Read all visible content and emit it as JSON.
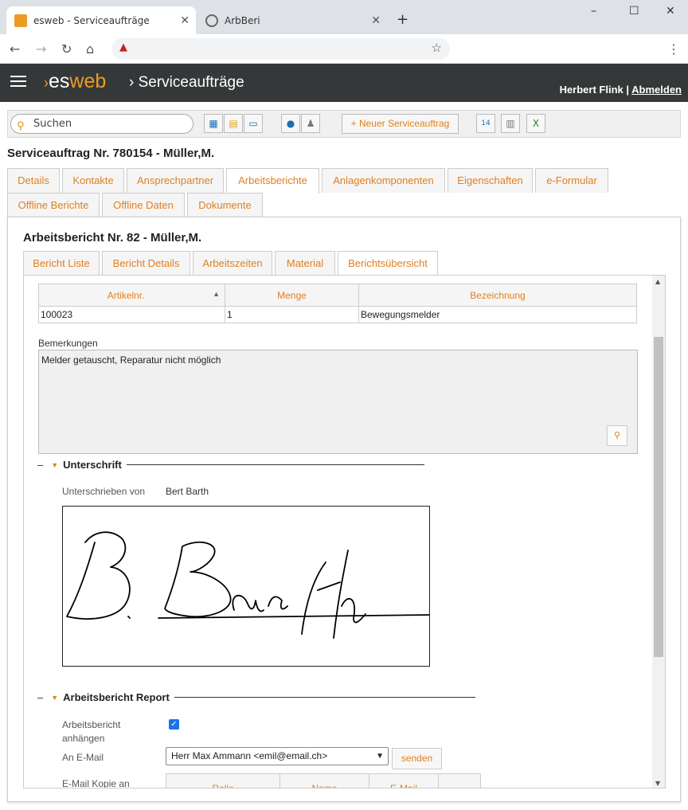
{
  "browser": {
    "tabs": [
      {
        "title": "esweb - Serviceaufträge",
        "active": true
      },
      {
        "title": "ArbBeri",
        "active": false
      }
    ],
    "new_tab": "+",
    "window_controls": {
      "minimize": "–",
      "maximize": "☐",
      "close": "✕"
    }
  },
  "app": {
    "logo_es": "es",
    "logo_web": "web",
    "breadcrumb": "Serviceaufträge",
    "user_name": "Herbert Flink",
    "separator": "|",
    "logout": "Abmelden",
    "accent": "#ec9c24"
  },
  "toolbar": {
    "search_placeholder": "Suchen",
    "new_button": "Neuer Serviceauftrag"
  },
  "page_title": "Serviceauftrag Nr. 780154 - Müller,M.",
  "main_tabs": [
    "Details",
    "Kontakte",
    "Ansprechpartner",
    "Arbeitsberichte",
    "Anlagenkomponenten",
    "Eigenschaften",
    "e-Formular",
    "Offline Berichte",
    "Offline Daten",
    "Dokumente"
  ],
  "active_main_tab": "Arbeitsberichte",
  "report": {
    "title": "Arbeitsbericht Nr. 82 - Müller,M.",
    "tabs": [
      "Bericht Liste",
      "Bericht Details",
      "Arbeitszeiten",
      "Material",
      "Berichtsübersicht"
    ],
    "active_tab": "Berichtsübersicht"
  },
  "material_table": {
    "columns": [
      "Artikelnr.",
      "Menge",
      "Bezeichnung"
    ],
    "rows": [
      [
        "100023",
        "1",
        "Bewegungsmelder"
      ]
    ]
  },
  "remarks": {
    "label": "Bemerkungen",
    "value": "Melder getauscht, Reparatur nicht möglich"
  },
  "signature": {
    "section_title": "Unterschrift",
    "signed_by_label": "Unterschrieben von",
    "signed_by_value": "Bert Barth"
  },
  "report_section": {
    "title": "Arbeitsbericht Report",
    "attach_label_line1": "Arbeitsbericht",
    "attach_label_line2": "anhängen",
    "attach_checked": true,
    "email_label": "An E-Mail",
    "email_value": "Herr Max Ammann <emil@email.ch>",
    "send_button": "senden",
    "cc_label": "E-Mail Kopie an",
    "cc_columns": [
      "Rolle",
      "Name",
      "E-Mail",
      ""
    ]
  }
}
